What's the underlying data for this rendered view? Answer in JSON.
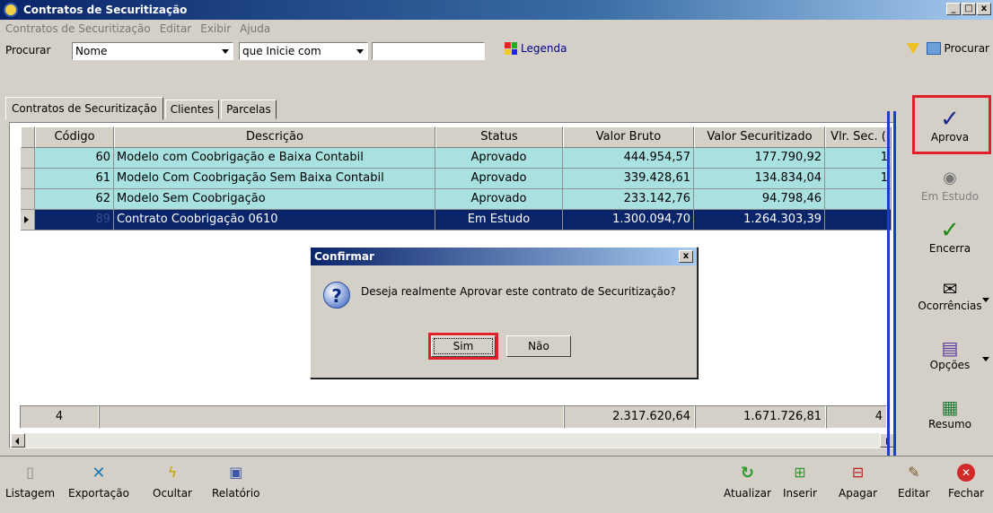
{
  "window": {
    "title": "Contratos de Securitização"
  },
  "menu": [
    "Contratos de Securitização",
    "Editar",
    "Exibir",
    "Ajuda"
  ],
  "search": {
    "label": "Procurar",
    "field": "Nome",
    "mode": "que Inicie com",
    "value": "",
    "legenda": "Legenda",
    "procurar_button": "Procurar"
  },
  "tabs": [
    "Contratos de Securitização",
    "Clientes",
    "Parcelas"
  ],
  "grid": {
    "columns": [
      "Código",
      "Descrição",
      "Status",
      "Valor Bruto",
      "Valor Securitizado",
      "Vlr. Sec. ("
    ],
    "rows": [
      {
        "codigo": "60",
        "descricao": "Modelo com Coobrigação e Baixa Contabil",
        "status": "Aprovado",
        "bruto": "444.954,57",
        "securitizado": "177.790,92",
        "vlr": "1"
      },
      {
        "codigo": "61",
        "descricao": "Modelo Com Coobrigação Sem Baixa Contabil",
        "status": "Aprovado",
        "bruto": "339.428,61",
        "securitizado": "134.834,04",
        "vlr": "1"
      },
      {
        "codigo": "62",
        "descricao": "Modelo Sem Coobrigação",
        "status": "Aprovado",
        "bruto": "233.142,76",
        "securitizado": "94.798,46",
        "vlr": ""
      },
      {
        "codigo": "89",
        "descricao": "Contrato Coobrigação 0610",
        "status": "Em Estudo",
        "bruto": "1.300.094,70",
        "securitizado": "1.264.303,39",
        "vlr": ""
      }
    ],
    "totals": {
      "count": "4",
      "bruto": "2.317.620,64",
      "securitizado": "1.671.726,81",
      "vlr": "4"
    }
  },
  "dialog": {
    "title": "Confirmar",
    "message": "Deseja realmente Aprovar este contrato de Securitização?",
    "yes": "Sim",
    "no": "Não"
  },
  "side_actions": [
    "Aprova",
    "Em Estudo",
    "Encerra",
    "Ocorrências",
    "Opções",
    "Resumo"
  ],
  "bottom_actions": [
    "Listagem",
    "Exportação",
    "Ocultar",
    "Relatório",
    "Atualizar",
    "Inserir",
    "Apagar",
    "Editar",
    "Fechar"
  ],
  "colors": {
    "row_bg": "#a8e1e0",
    "selected_bg": "#0a246a",
    "highlight": "#e0202a"
  }
}
